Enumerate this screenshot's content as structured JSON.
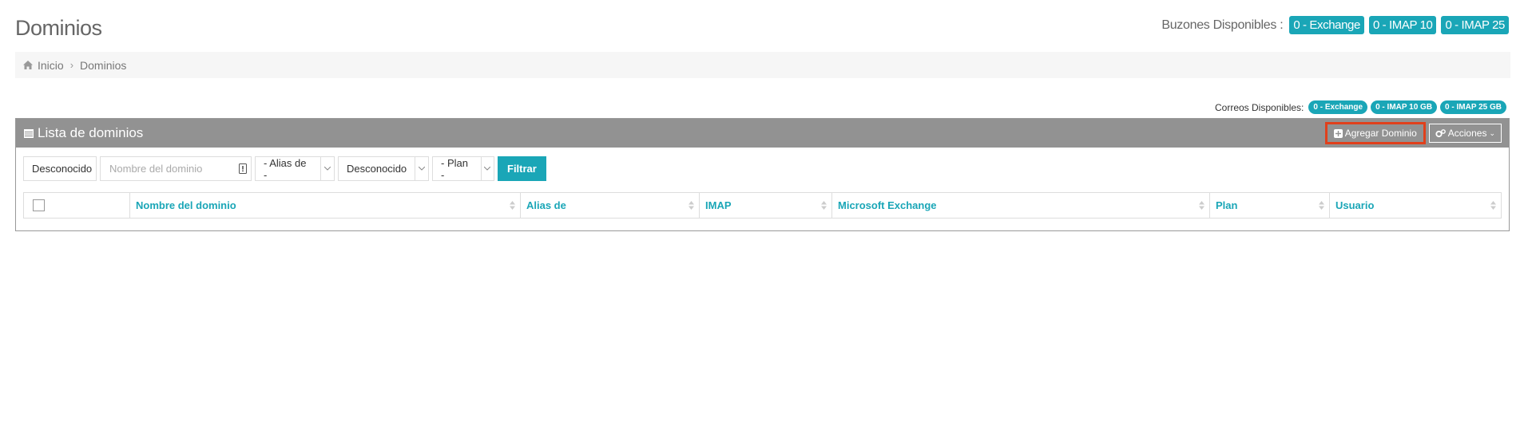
{
  "page": {
    "title": "Dominios"
  },
  "mailboxes": {
    "label": "Buzones Disponibles :",
    "badges": [
      "0 - Exchange",
      "0 - IMAP 10",
      "0 - IMAP 25"
    ]
  },
  "breadcrumb": {
    "items": [
      "Inicio",
      "Dominios"
    ]
  },
  "mail_available": {
    "label": "Correos Disponibles:",
    "badges": [
      "0 - Exchange",
      "0 - IMAP 10 GB",
      "0 - IMAP 25 GB"
    ]
  },
  "panel": {
    "title": "Lista de dominios",
    "add_label": "Agregar Dominio",
    "actions_label": "Acciones"
  },
  "filters": {
    "status": "Desconocido",
    "domain_placeholder": "Nombre del dominio",
    "alias": "- Alias de -",
    "status2": "Desconocido",
    "plan": "- Plan -",
    "filter_label": "Filtrar"
  },
  "table": {
    "columns": [
      "Nombre del dominio",
      "Alias de",
      "IMAP",
      "Microsoft Exchange",
      "Plan",
      "Usuario"
    ]
  },
  "colors": {
    "accent": "#1aa6b7",
    "panel_header": "#929292",
    "highlight": "#e0401c"
  }
}
